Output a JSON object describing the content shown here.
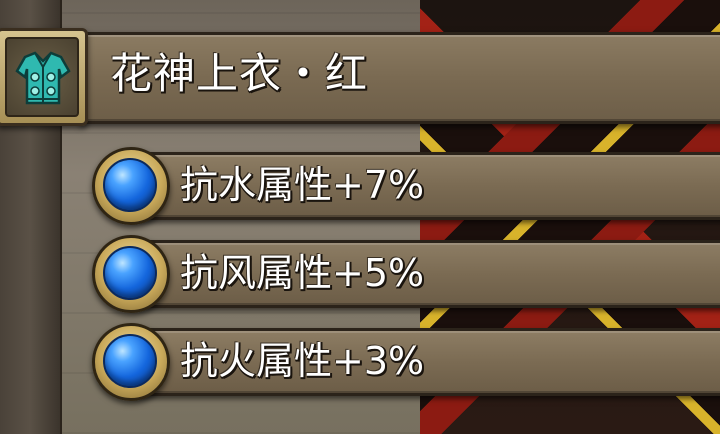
{
  "item": {
    "name": "花神上衣・红",
    "icon": "armor-icon"
  },
  "stats": [
    {
      "label": "抗水属性+7%",
      "icon": "blue-gem-icon"
    },
    {
      "label": "抗风属性+5%",
      "icon": "blue-gem-icon"
    },
    {
      "label": "抗火属性+3%",
      "icon": "blue-gem-icon"
    }
  ],
  "colors": {
    "bar": "#7b6b53",
    "bar_border": "#2b231a",
    "gem_blue": "#1466dd",
    "orb_gold": "#c9a95a",
    "text": "#ffffff",
    "icon_teal": "#3fc9c0"
  }
}
